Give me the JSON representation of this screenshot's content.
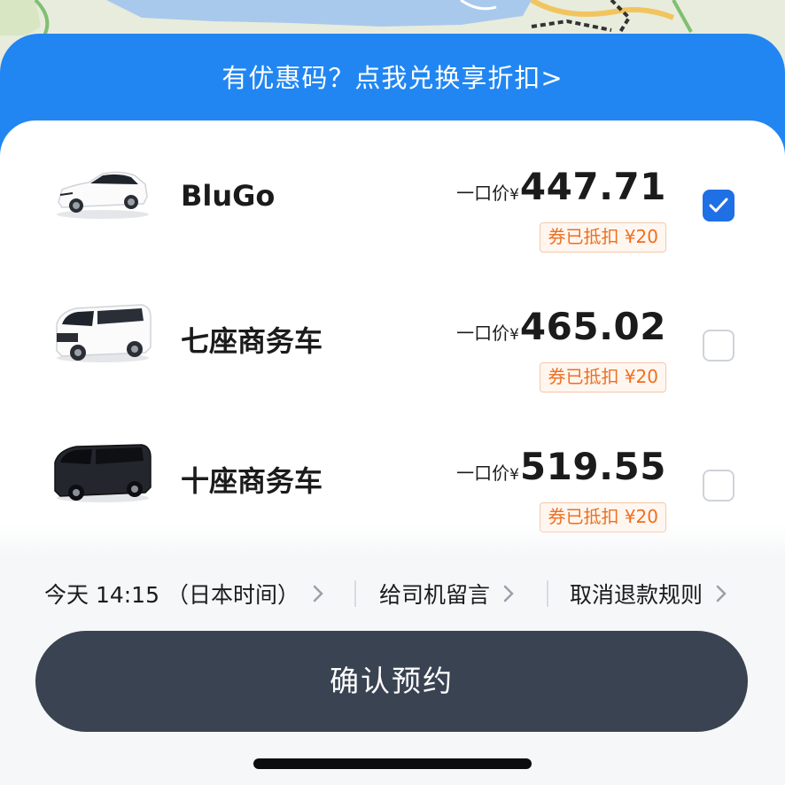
{
  "promo": {
    "text": "有优惠码？点我兑换享折扣>"
  },
  "vehicles": [
    {
      "name": "BluGo",
      "price_prefix": "一口价",
      "currency": "¥",
      "price": "447.71",
      "coupon": "券已抵扣 ¥20",
      "selected": true,
      "icon": "white-sedan-car-icon"
    },
    {
      "name": "七座商务车",
      "price_prefix": "一口价",
      "currency": "¥",
      "price": "465.02",
      "coupon": "券已抵扣 ¥20",
      "selected": false,
      "icon": "white-minivan-icon"
    },
    {
      "name": "十座商务车",
      "price_prefix": "一口价",
      "currency": "¥",
      "price": "519.55",
      "coupon": "券已抵扣 ¥20",
      "selected": false,
      "icon": "black-van-icon"
    }
  ],
  "options": [
    {
      "label": "今天 14:15 （日本时间）",
      "icon": "chevron-right-icon"
    },
    {
      "label": "给司机留言",
      "icon": "chevron-right-icon"
    },
    {
      "label": "取消退款规则",
      "icon": "chevron-right-icon"
    }
  ],
  "confirm": {
    "label": "确认预约"
  },
  "colors": {
    "promo_bg": "#2186f2",
    "checkbox_on": "#1f6fe5",
    "coupon_text": "#ee6f1f",
    "coupon_border": "#f6c8a8",
    "confirm_bg": "#3a4352"
  }
}
